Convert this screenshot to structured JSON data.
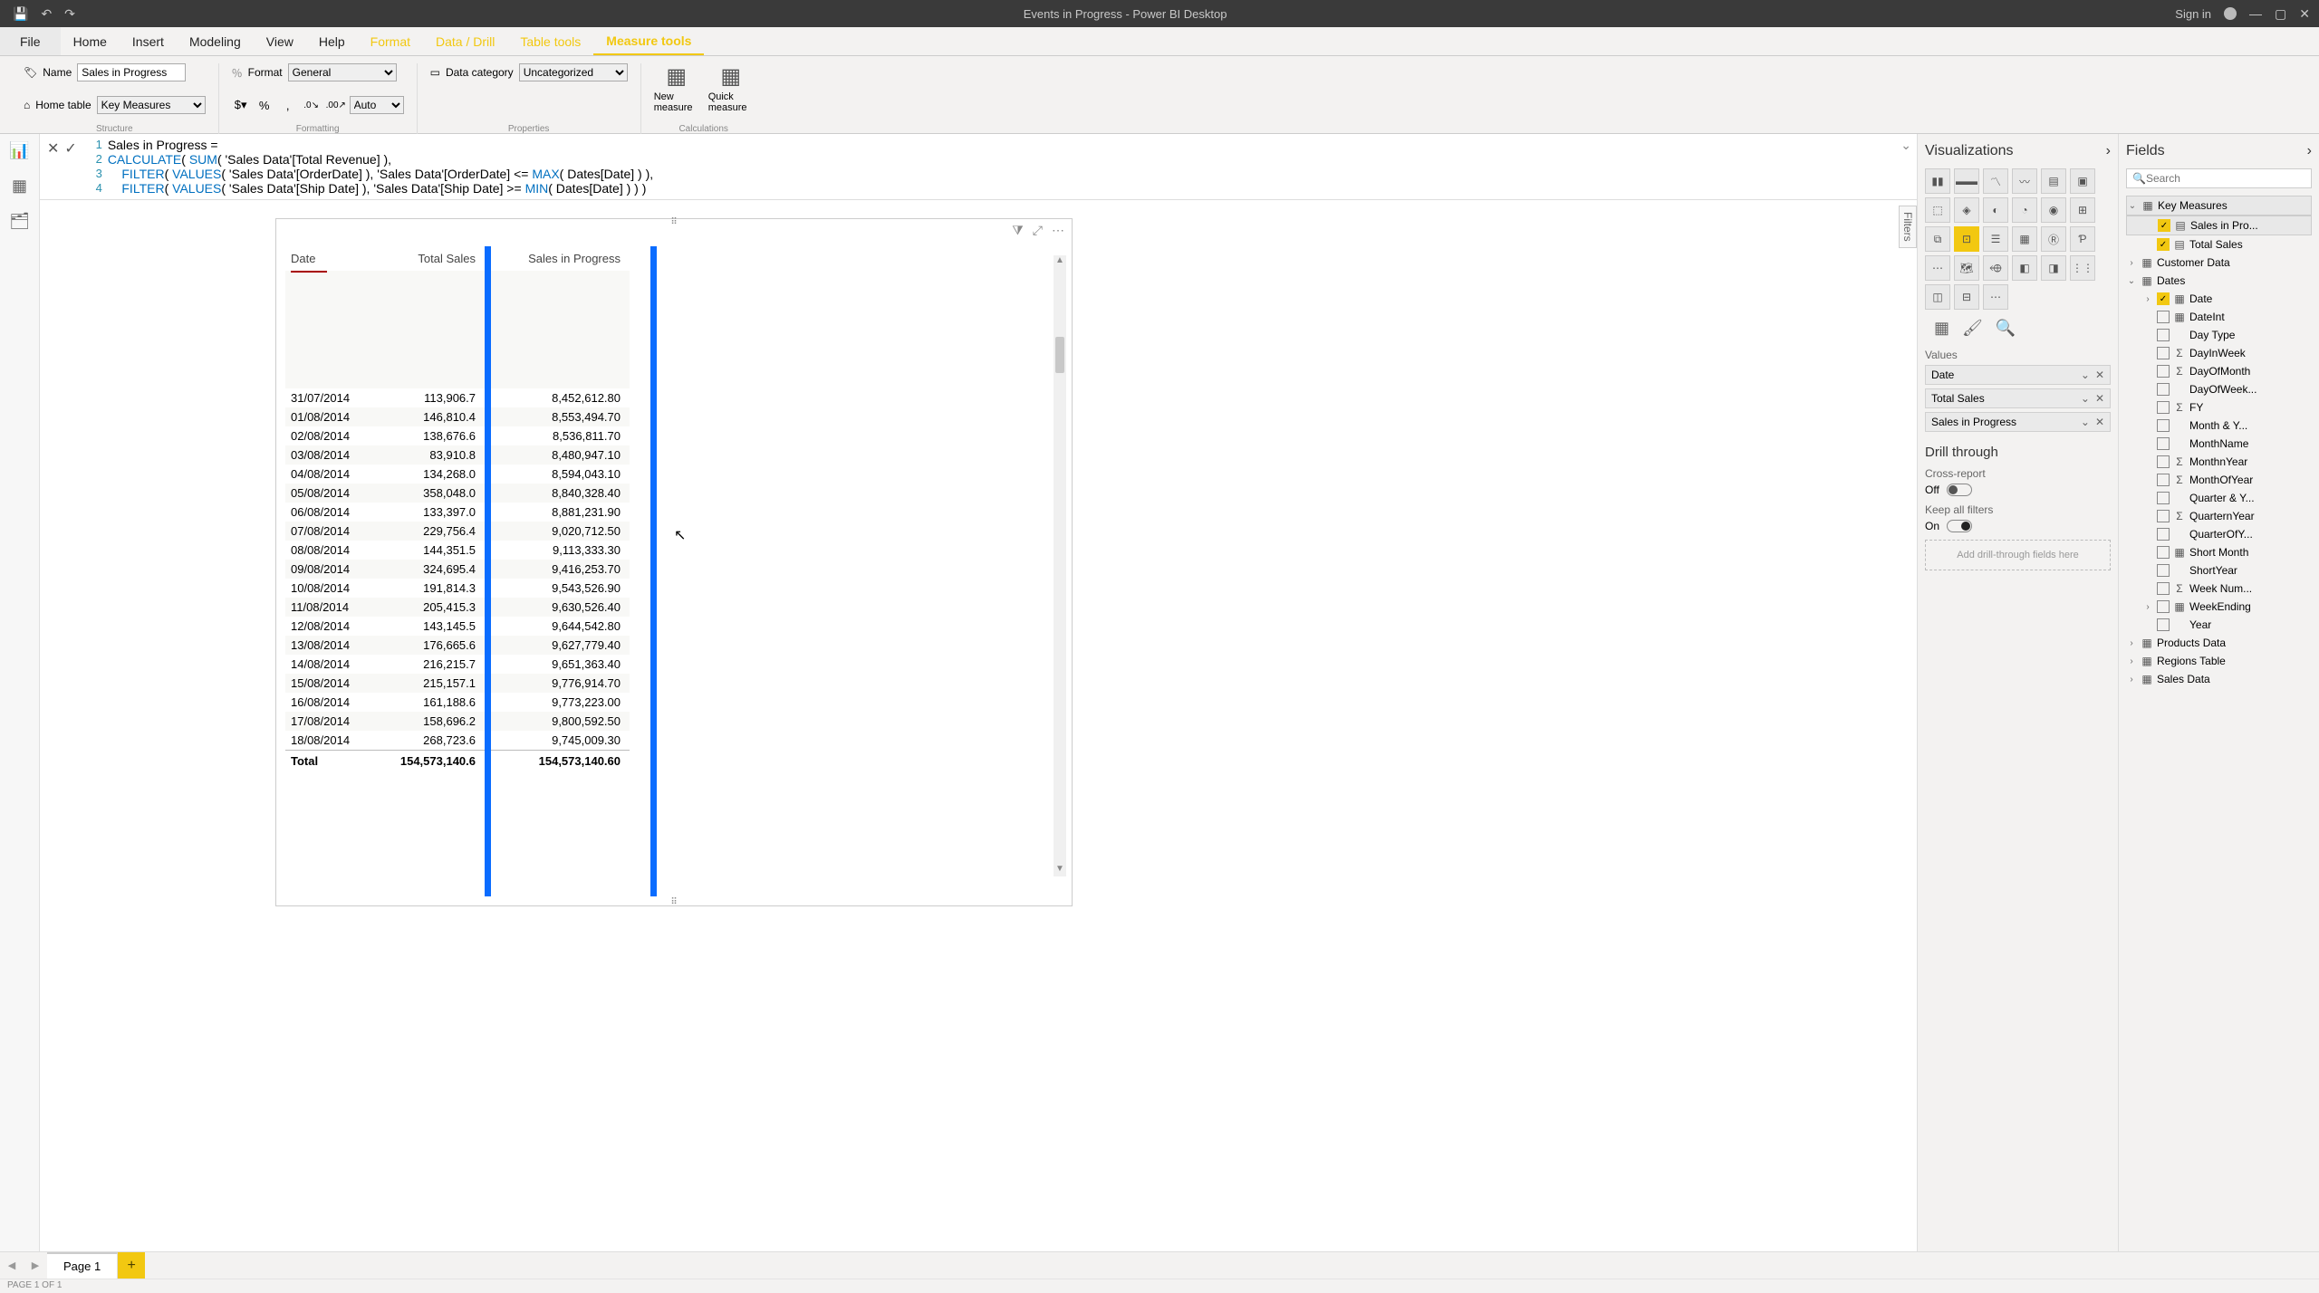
{
  "title_bar": {
    "title": "Events in Progress - Power BI Desktop",
    "signin": "Sign in"
  },
  "menu": {
    "file": "File",
    "tabs": [
      "Home",
      "Insert",
      "Modeling",
      "View",
      "Help",
      "Format",
      "Data / Drill",
      "Table tools",
      "Measure tools"
    ],
    "context_start_index": 5,
    "active": "Measure tools"
  },
  "ribbon": {
    "name_label": "Name",
    "name_value": "Sales in Progress",
    "home_table_label": "Home table",
    "home_table_value": "Key Measures",
    "format_label": "Format",
    "format_value": "General",
    "auto_label": "Auto",
    "data_category_label": "Data category",
    "data_category_value": "Uncategorized",
    "new_measure": "New measure",
    "quick_measure": "Quick measure",
    "group_structure": "Structure",
    "group_formatting": "Formatting",
    "group_properties": "Properties",
    "group_calculations": "Calculations"
  },
  "formula": {
    "lines": [
      {
        "num": "1",
        "pre": "",
        "kw1": "",
        "mid": "Sales in Progress ="
      },
      {
        "num": "2",
        "pre": "",
        "kw1": "CALCULATE",
        "mid": "( ",
        "kw2": "SUM",
        "post": "( 'Sales Data'[Total Revenue] ),"
      },
      {
        "num": "3",
        "pre": "    ",
        "kw1": "FILTER",
        "mid": "( ",
        "kw2": "VALUES",
        "post": "( 'Sales Data'[OrderDate] ), 'Sales Data'[OrderDate] <= ",
        "kw3": "MAX",
        "tail": "( Dates[Date] ) ),"
      },
      {
        "num": "4",
        "pre": "    ",
        "kw1": "FILTER",
        "mid": "( ",
        "kw2": "VALUES",
        "post": "( 'Sales Data'[Ship Date] ), 'Sales Data'[Ship Date] >= ",
        "kw3": "MIN",
        "tail": "( Dates[Date] ) ) )"
      }
    ]
  },
  "table": {
    "headers": {
      "date": "Date",
      "total_sales": "Total Sales",
      "sip": "Sales in Progress"
    },
    "rows": [
      {
        "date": "31/07/2014",
        "ts": "113,906.7",
        "sip": "8,452,612.80"
      },
      {
        "date": "01/08/2014",
        "ts": "146,810.4",
        "sip": "8,553,494.70"
      },
      {
        "date": "02/08/2014",
        "ts": "138,676.6",
        "sip": "8,536,811.70"
      },
      {
        "date": "03/08/2014",
        "ts": "83,910.8",
        "sip": "8,480,947.10"
      },
      {
        "date": "04/08/2014",
        "ts": "134,268.0",
        "sip": "8,594,043.10"
      },
      {
        "date": "05/08/2014",
        "ts": "358,048.0",
        "sip": "8,840,328.40"
      },
      {
        "date": "06/08/2014",
        "ts": "133,397.0",
        "sip": "8,881,231.90"
      },
      {
        "date": "07/08/2014",
        "ts": "229,756.4",
        "sip": "9,020,712.50"
      },
      {
        "date": "08/08/2014",
        "ts": "144,351.5",
        "sip": "9,113,333.30"
      },
      {
        "date": "09/08/2014",
        "ts": "324,695.4",
        "sip": "9,416,253.70"
      },
      {
        "date": "10/08/2014",
        "ts": "191,814.3",
        "sip": "9,543,526.90"
      },
      {
        "date": "11/08/2014",
        "ts": "205,415.3",
        "sip": "9,630,526.40"
      },
      {
        "date": "12/08/2014",
        "ts": "143,145.5",
        "sip": "9,644,542.80"
      },
      {
        "date": "13/08/2014",
        "ts": "176,665.6",
        "sip": "9,627,779.40"
      },
      {
        "date": "14/08/2014",
        "ts": "216,215.7",
        "sip": "9,651,363.40"
      },
      {
        "date": "15/08/2014",
        "ts": "215,157.1",
        "sip": "9,776,914.70"
      },
      {
        "date": "16/08/2014",
        "ts": "161,188.6",
        "sip": "9,773,223.00"
      },
      {
        "date": "17/08/2014",
        "ts": "158,696.2",
        "sip": "9,800,592.50"
      },
      {
        "date": "18/08/2014",
        "ts": "268,723.6",
        "sip": "9,745,009.30"
      }
    ],
    "footer": {
      "label": "Total",
      "ts": "154,573,140.6",
      "sip": "154,573,140.60"
    }
  },
  "viz_pane": {
    "title": "Visualizations",
    "values_label": "Values",
    "wells": [
      "Date",
      "Total Sales",
      "Sales in Progress"
    ],
    "drill_title": "Drill through",
    "cross_report": "Cross-report",
    "off": "Off",
    "keep_filters": "Keep all filters",
    "on": "On",
    "drop_hint": "Add drill-through fields here",
    "icons": [
      "▮▮",
      "▬▬",
      "〽",
      "〰",
      "▤",
      "▣",
      "⬚",
      "◈",
      "◐",
      "◔",
      "◉",
      "⊞",
      "⧉",
      "⊡",
      "☰",
      "▦",
      "Ⓡ",
      "Ƥ",
      "⋯",
      "🗺",
      "⬲",
      "◧",
      "◨",
      "⋮⋮",
      "◫",
      "⊟",
      "⋯"
    ],
    "selected_icon_index": 13
  },
  "fields_pane": {
    "title": "Fields",
    "search_placeholder": "Search",
    "tables": [
      {
        "name": "Key Measures",
        "open": true,
        "selected": true,
        "fields": [
          {
            "name": "Sales in Pro...",
            "checked": true,
            "selected": true,
            "icon": "▤"
          },
          {
            "name": "Total Sales",
            "checked": true,
            "icon": "▤"
          }
        ]
      },
      {
        "name": "Customer Data",
        "open": false
      },
      {
        "name": "Dates",
        "open": true,
        "fields": [
          {
            "name": "Date",
            "checked": true,
            "expand": true,
            "icon": "▦"
          },
          {
            "name": "DateInt",
            "icon": "▦"
          },
          {
            "name": "Day Type",
            "icon": ""
          },
          {
            "name": "DayInWeek",
            "icon": "Σ"
          },
          {
            "name": "DayOfMonth",
            "icon": "Σ"
          },
          {
            "name": "DayOfWeek...",
            "icon": ""
          },
          {
            "name": "FY",
            "icon": "Σ"
          },
          {
            "name": "Month & Y...",
            "icon": ""
          },
          {
            "name": "MonthName",
            "icon": ""
          },
          {
            "name": "MonthnYear",
            "icon": "Σ"
          },
          {
            "name": "MonthOfYear",
            "icon": "Σ"
          },
          {
            "name": "Quarter & Y...",
            "icon": ""
          },
          {
            "name": "QuarternYear",
            "icon": "Σ"
          },
          {
            "name": "QuarterOfY...",
            "icon": ""
          },
          {
            "name": "Short Month",
            "icon": "▦"
          },
          {
            "name": "ShortYear",
            "icon": ""
          },
          {
            "name": "Week Num...",
            "icon": "Σ"
          },
          {
            "name": "WeekEnding",
            "expand": true,
            "icon": "▦"
          },
          {
            "name": "Year",
            "icon": ""
          }
        ]
      },
      {
        "name": "Products Data",
        "open": false
      },
      {
        "name": "Regions Table",
        "open": false
      },
      {
        "name": "Sales Data",
        "open": false
      }
    ]
  },
  "filters_tab": "Filters",
  "page_tabs": {
    "page1": "Page 1"
  },
  "status": "PAGE 1 OF 1"
}
